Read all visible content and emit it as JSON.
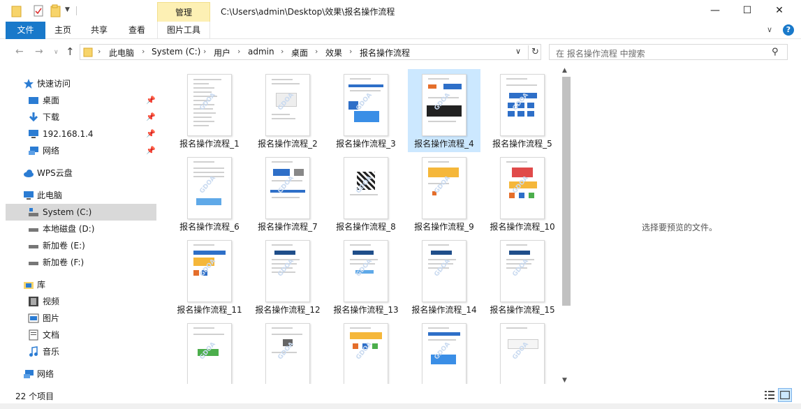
{
  "titlebar": {
    "manage_label": "管理",
    "path": "C:\\Users\\admin\\Desktop\\效果\\报名操作流程",
    "minimize": "—",
    "maximize": "☐",
    "close": "✕"
  },
  "ribbon": {
    "tabs": [
      {
        "label": "文件"
      },
      {
        "label": "主页"
      },
      {
        "label": "共享"
      },
      {
        "label": "查看"
      },
      {
        "label": "图片工具"
      }
    ],
    "help": "?"
  },
  "address": {
    "crumbs": [
      "此电脑",
      "System (C:)",
      "用户",
      "admin",
      "桌面",
      "效果",
      "报名操作流程"
    ],
    "search_placeholder": "在 报名操作流程 中搜索"
  },
  "sidebar": {
    "items": [
      {
        "label": "快速访问",
        "icon": "star-icon"
      },
      {
        "label": "桌面",
        "icon": "desktop-icon",
        "pinned": true
      },
      {
        "label": "下载",
        "icon": "download-icon",
        "pinned": true
      },
      {
        "label": "192.168.1.4",
        "icon": "network-drive-icon",
        "pinned": true
      },
      {
        "label": "网络",
        "icon": "network-icon",
        "pinned": true
      },
      {
        "label": "WPS云盘",
        "icon": "cloud-icon"
      },
      {
        "label": "此电脑",
        "icon": "computer-icon"
      },
      {
        "label": "System (C:)",
        "icon": "drive-c-icon",
        "selected": true
      },
      {
        "label": "本地磁盘 (D:)",
        "icon": "drive-icon"
      },
      {
        "label": "新加卷 (E:)",
        "icon": "drive-icon"
      },
      {
        "label": "新加卷 (F:)",
        "icon": "drive-icon"
      },
      {
        "label": "库",
        "icon": "library-icon"
      },
      {
        "label": "视频",
        "icon": "video-icon"
      },
      {
        "label": "图片",
        "icon": "picture-icon"
      },
      {
        "label": "文档",
        "icon": "document-icon"
      },
      {
        "label": "音乐",
        "icon": "music-icon"
      },
      {
        "label": "网络",
        "icon": "network-icon"
      }
    ]
  },
  "files": [
    {
      "name": "报名操作流程_1"
    },
    {
      "name": "报名操作流程_2"
    },
    {
      "name": "报名操作流程_3"
    },
    {
      "name": "报名操作流程_4",
      "selected": true
    },
    {
      "name": "报名操作流程_5"
    },
    {
      "name": "报名操作流程_6"
    },
    {
      "name": "报名操作流程_7"
    },
    {
      "name": "报名操作流程_8"
    },
    {
      "name": "报名操作流程_9"
    },
    {
      "name": "报名操作流程_10"
    },
    {
      "name": "报名操作流程_11"
    },
    {
      "name": "报名操作流程_12"
    },
    {
      "name": "报名操作流程_13"
    },
    {
      "name": "报名操作流程_14"
    },
    {
      "name": "报名操作流程_15"
    },
    {
      "name": ""
    },
    {
      "name": ""
    },
    {
      "name": ""
    },
    {
      "name": ""
    },
    {
      "name": ""
    }
  ],
  "preview": {
    "text": "选择要预览的文件。"
  },
  "status": {
    "count": "22 个项目"
  },
  "colors": {
    "accent": "#1979ca",
    "selection": "#cce8ff",
    "manage_tab": "#fdf0b4"
  }
}
